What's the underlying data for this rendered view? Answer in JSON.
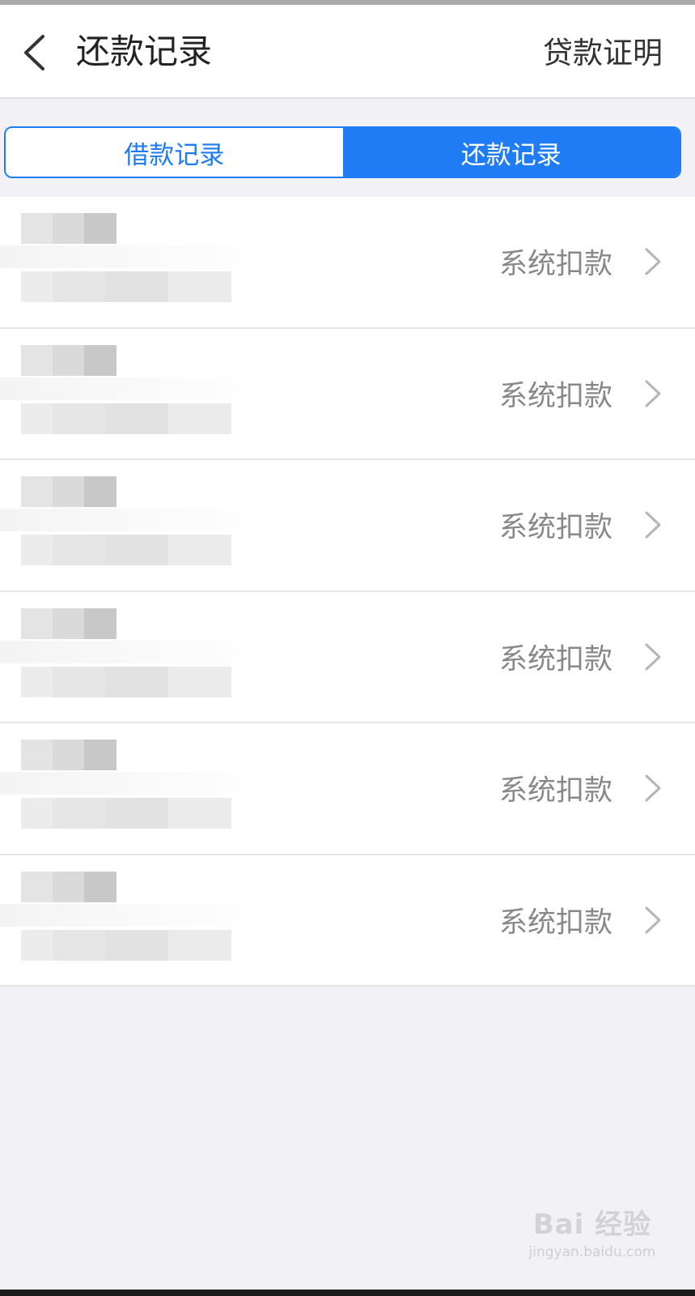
{
  "header": {
    "back_icon": "chevron-left-icon",
    "title": "还款记录",
    "right_link": "贷款证明"
  },
  "tabs": [
    {
      "label": "借款记录",
      "active": false
    },
    {
      "label": "还款记录",
      "active": true
    }
  ],
  "records": [
    {
      "status": "系统扣款",
      "amount_redacted": true,
      "date_redacted": true
    },
    {
      "status": "系统扣款",
      "amount_redacted": true,
      "date_redacted": true
    },
    {
      "status": "系统扣款",
      "amount_redacted": true,
      "date_redacted": true
    },
    {
      "status": "系统扣款",
      "amount_redacted": true,
      "date_redacted": true
    },
    {
      "status": "系统扣款",
      "amount_redacted": true,
      "date_redacted": true
    },
    {
      "status": "系统扣款",
      "amount_redacted": true,
      "date_redacted": true
    }
  ],
  "watermark": {
    "brand": "Bai 经验",
    "url": "jingyan.baidu.com"
  },
  "colors": {
    "accent": "#1f7cf5",
    "status_text": "#888888",
    "background": "#f2f2f6"
  }
}
